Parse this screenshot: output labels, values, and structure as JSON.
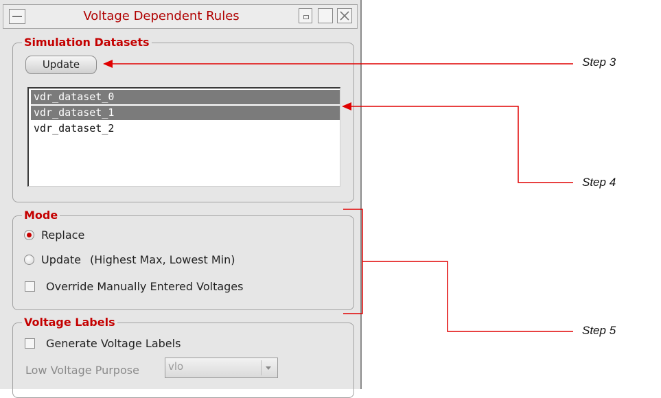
{
  "window": {
    "title": "Voltage Dependent Rules"
  },
  "simulation_datasets": {
    "title": "Simulation Datasets",
    "update_button": "Update",
    "items": [
      {
        "label": "vdr_dataset_0",
        "selected": true
      },
      {
        "label": "vdr_dataset_1",
        "selected": true
      },
      {
        "label": "vdr_dataset_2",
        "selected": false
      }
    ]
  },
  "mode": {
    "title": "Mode",
    "replace_label": "Replace",
    "update_label": "Update",
    "update_note": "(Highest Max, Lowest Min)",
    "override_label": "Override Manually Entered Voltages",
    "selected": "Replace",
    "override_checked": false
  },
  "voltage_labels": {
    "title": "Voltage Labels",
    "generate_label": "Generate Voltage Labels",
    "generate_checked": false,
    "low_voltage_purpose_label": "Low Voltage Purpose",
    "low_voltage_purpose_value": "vlo"
  },
  "annotations": {
    "step3": "Step 3",
    "step4": "Step 4",
    "step5": "Step 5",
    "arrow_color": "#e00000"
  }
}
